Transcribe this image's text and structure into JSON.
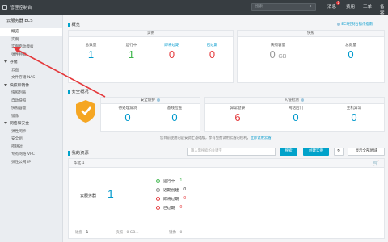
{
  "topbar": {
    "title": "管理控制台",
    "search_placeholder": "搜索",
    "items": [
      {
        "label": "消息",
        "badge": "2"
      },
      {
        "label": "费用"
      },
      {
        "label": "工单"
      },
      {
        "label": "备案"
      }
    ]
  },
  "sidebar": {
    "header": "云服务器 ECS",
    "entries": [
      {
        "type": "item",
        "label": "概览",
        "active": true
      },
      {
        "type": "item",
        "label": "实例"
      },
      {
        "type": "item",
        "label": "实例启动模板"
      },
      {
        "type": "item",
        "label": "弹性伸缩"
      },
      {
        "type": "group",
        "label": "存储"
      },
      {
        "type": "item",
        "label": "云盘"
      },
      {
        "type": "item",
        "label": "文件存储 NAS"
      },
      {
        "type": "group",
        "label": "快照和镜像"
      },
      {
        "type": "item",
        "label": "快照列表"
      },
      {
        "type": "item",
        "label": "自动快照"
      },
      {
        "type": "item",
        "label": "快照容量"
      },
      {
        "type": "item",
        "label": "镜像"
      },
      {
        "type": "group",
        "label": "网络和安全"
      },
      {
        "type": "item",
        "label": "弹性网卡"
      },
      {
        "type": "item",
        "label": "安全组"
      },
      {
        "type": "item",
        "label": "密钥对"
      },
      {
        "type": "item",
        "label": "专有网络 VPC"
      },
      {
        "type": "item",
        "label": "弹性公网 IP"
      }
    ]
  },
  "overview": {
    "title": "概览",
    "help_link": "ECS控制台操作指南",
    "instance_panel": {
      "header": "实例",
      "stats": [
        {
          "label": "总数量",
          "value": "1"
        },
        {
          "label": "运行中",
          "value": "1"
        },
        {
          "label": "即将过期",
          "value": "0"
        },
        {
          "label": "已过期",
          "value": "0"
        }
      ]
    },
    "snapshot_panel": {
      "header": "快照",
      "stats": [
        {
          "label": "快照容量",
          "value": "0",
          "unit": "GB"
        },
        {
          "label": "总数量",
          "value": "0"
        }
      ]
    }
  },
  "security": {
    "title": "安全概况",
    "security_panel": {
      "header": "安全防护",
      "stats": [
        {
          "label": "待处理漏洞",
          "value": "0"
        },
        {
          "label": "基线检查",
          "value": "0"
        }
      ]
    },
    "intrusion_panel": {
      "header": "入侵检测",
      "stats": [
        {
          "label": "异常登录",
          "value": "6"
        },
        {
          "label": "网站后门",
          "value": "0"
        },
        {
          "label": "主机异常",
          "value": "0"
        }
      ]
    },
    "note": "您目前使用的是安骑士基础版，享有免费试用云盾的权利，",
    "note_link": "立即试用云盾"
  },
  "resources": {
    "title": "我的资源",
    "search_placeholder": "输入需搜索的关键字",
    "search_button": "搜索",
    "create_button": "创建实例",
    "refresh_icon": "refresh-icon",
    "show_all_button": "显示全部地域",
    "region": {
      "name": "华北 1",
      "label": "云服务器",
      "count": "1",
      "status": [
        {
          "label": "运行中",
          "value": "1",
          "color": "#3bb54a"
        },
        {
          "label": "近期创建",
          "value": "0",
          "color": "#888888"
        },
        {
          "label": "即将过期",
          "value": "0",
          "color": "#e4393c"
        },
        {
          "label": "已过期",
          "value": "0",
          "color": "#e4393c"
        }
      ],
      "footer": [
        {
          "label": "磁盘",
          "value": "1"
        },
        {
          "label": "快照",
          "value": "0 GB..."
        },
        {
          "label": "镜像",
          "value": "0"
        }
      ]
    }
  },
  "colors": {
    "accent": "#00a2ca",
    "topbar": "#373d41",
    "annotation_arrow": "#e4393c",
    "alert_icon": "#f5a623"
  }
}
